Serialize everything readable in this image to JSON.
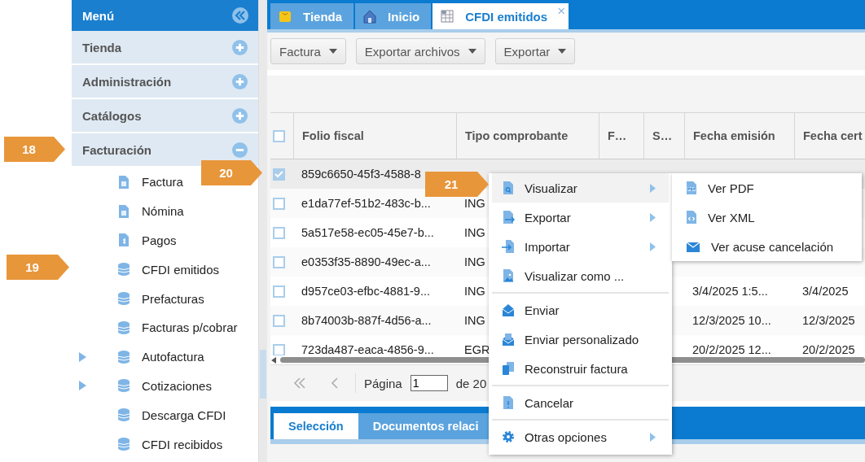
{
  "callouts": [
    {
      "label": "18"
    },
    {
      "label": "19"
    },
    {
      "label": "20"
    },
    {
      "label": "21"
    }
  ],
  "sidebar": {
    "title": "Menú",
    "sections": [
      {
        "label": "Tienda",
        "expanded": false
      },
      {
        "label": "Administración",
        "expanded": false
      },
      {
        "label": "Catálogos",
        "expanded": false
      },
      {
        "label": "Facturación",
        "expanded": true,
        "items": [
          {
            "label": "Factura",
            "kind": "document",
            "expandable": false
          },
          {
            "label": "Nómina",
            "kind": "document",
            "expandable": false
          },
          {
            "label": "Pagos",
            "kind": "payment",
            "expandable": false
          },
          {
            "label": "CFDI emitidos",
            "kind": "database",
            "expandable": false
          },
          {
            "label": "Prefacturas",
            "kind": "database",
            "expandable": false
          },
          {
            "label": "Facturas p/cobrar",
            "kind": "database",
            "expandable": false
          },
          {
            "label": "Autofactura",
            "kind": "database",
            "expandable": true
          },
          {
            "label": "Cotizaciones",
            "kind": "database",
            "expandable": true
          },
          {
            "label": "Descarga CFDI",
            "kind": "database",
            "expandable": false
          },
          {
            "label": "CFDI recibidos",
            "kind": "database",
            "expandable": false
          }
        ]
      }
    ]
  },
  "tabs": [
    {
      "label": "Tienda",
      "kind": "bag",
      "selected": false,
      "closable": false
    },
    {
      "label": "Inicio",
      "kind": "house",
      "selected": false,
      "closable": false
    },
    {
      "label": "CFDI emitidos",
      "kind": "table",
      "selected": true,
      "closable": true
    }
  ],
  "close_glyph": "×",
  "toolbar": [
    "Factura",
    "Exportar archivos",
    "Exportar"
  ],
  "table": {
    "select_all_checked": false,
    "columns": [
      "Folio fiscal",
      "Tipo comprobante",
      "F…",
      "S…",
      "Fecha emisión",
      "Fecha cert"
    ],
    "rows": [
      {
        "checked": true,
        "selected": true,
        "folio": "859c6650-45f3-4588-8"
      },
      {
        "checked": false,
        "selected": false,
        "folio": "e1da77ef-51b2-483c-b...",
        "tipo": "ING"
      },
      {
        "checked": false,
        "selected": false,
        "folio": "5a517e58-ec05-45e7-b...",
        "tipo": "ING"
      },
      {
        "checked": false,
        "selected": false,
        "folio": "e0353f35-8890-49ec-a...",
        "tipo": "ING"
      },
      {
        "checked": false,
        "selected": false,
        "folio": "d957ce03-efbc-4881-9...",
        "tipo": "ING",
        "emision": "3/4/2025 1:5...",
        "cert": "3/4/2025"
      },
      {
        "checked": false,
        "selected": false,
        "folio": "8b74003b-887f-4d56-a...",
        "tipo": "ING",
        "emision": "12/3/2025 10...",
        "cert": "12/3/2025"
      },
      {
        "checked": false,
        "selected": false,
        "folio": "723da487-eaca-4856-9...",
        "tipo": "EGR",
        "emision": "20/2/2025 12...",
        "cert": "20/2/2025"
      }
    ]
  },
  "pagination": {
    "label": "Página",
    "page": "1",
    "total": "de 20"
  },
  "bottom_tabs": [
    {
      "label": "Selección",
      "selected": true
    },
    {
      "label": "Documentos relaci",
      "selected": false
    }
  ],
  "context_menu": {
    "groups": [
      [
        {
          "label": "Visualizar",
          "kind": "magnifier-document",
          "submenu": true,
          "selected": true
        },
        {
          "label": "Exportar",
          "kind": "export",
          "submenu": true,
          "selected": false
        },
        {
          "label": "Importar",
          "kind": "import",
          "submenu": true,
          "selected": false
        },
        {
          "label": "Visualizar como ...",
          "kind": "image-document",
          "submenu": false,
          "selected": false
        }
      ],
      [
        {
          "label": "Enviar",
          "kind": "envelope",
          "submenu": false,
          "selected": false
        },
        {
          "label": "Enviar personalizado",
          "kind": "envelope-letter",
          "submenu": false,
          "selected": false
        },
        {
          "label": "Reconstruir factura",
          "kind": "copy",
          "submenu": false,
          "selected": false
        }
      ],
      [
        {
          "label": "Cancelar",
          "kind": "alert-document",
          "submenu": false,
          "selected": false
        }
      ],
      [
        {
          "label": "Otras opciones",
          "kind": "gear",
          "submenu": true,
          "selected": false
        }
      ]
    ]
  },
  "submenu": {
    "items": [
      {
        "label": "Ver PDF",
        "kind": "pdf"
      },
      {
        "label": "Ver XML",
        "kind": "code-document"
      },
      {
        "label": "Ver acuse cancelación",
        "kind": "closed-envelope"
      }
    ]
  }
}
